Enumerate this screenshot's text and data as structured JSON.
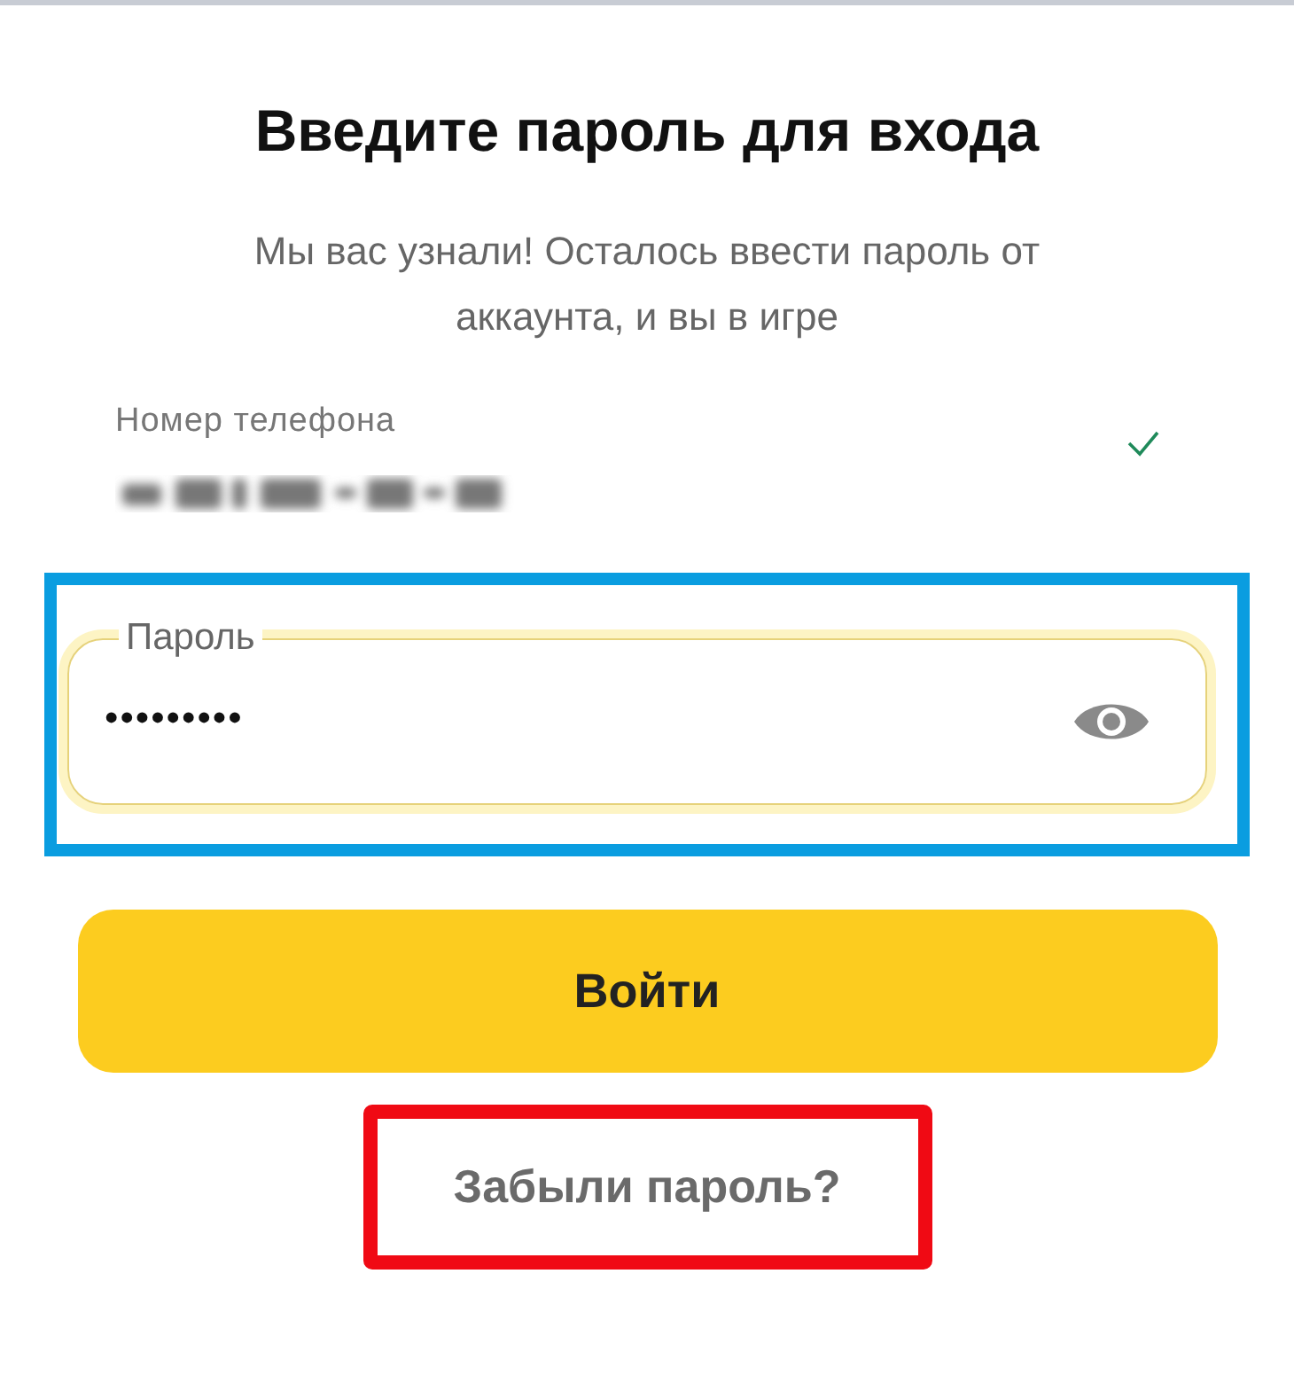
{
  "title": "Введите пароль для входа",
  "subtitle": "Мы вас узнали! Осталось ввести пароль от аккаунта, и вы в игре",
  "phone_field": {
    "label": "Номер телефона",
    "verified": true
  },
  "password_field": {
    "label": "Пароль",
    "value": "•••••••••",
    "focused": true
  },
  "login_button": {
    "label": "Войти"
  },
  "forgot_link": {
    "label": "Забыли пароль?"
  },
  "annotation_frames": [
    {
      "color": "#0a9de0"
    },
    {
      "color": "#f00a14"
    }
  ]
}
